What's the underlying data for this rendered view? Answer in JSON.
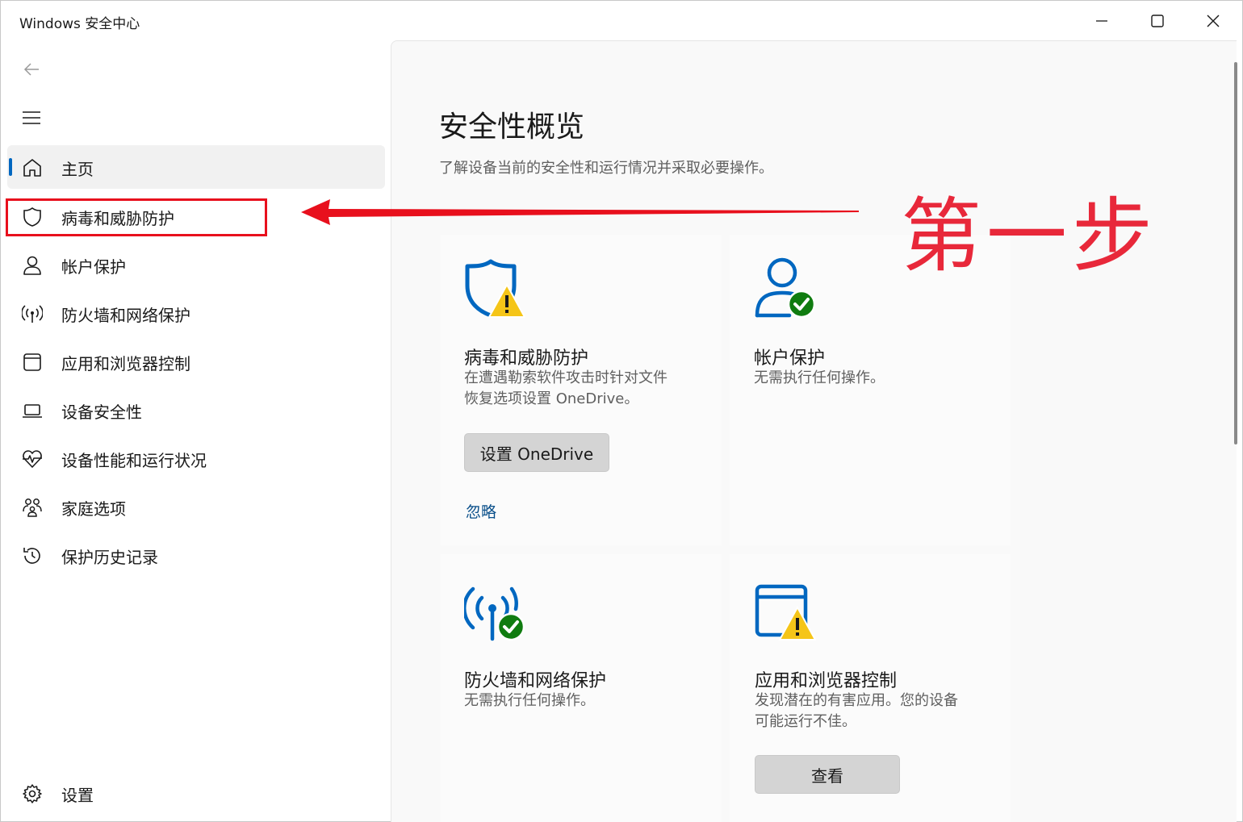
{
  "window": {
    "title": "Windows 安全中心"
  },
  "nav": {
    "items": [
      {
        "label": "主页",
        "icon": "home-icon",
        "active": true
      },
      {
        "label": "病毒和威胁防护",
        "icon": "shield-icon"
      },
      {
        "label": "帐户保护",
        "icon": "person-icon"
      },
      {
        "label": "防火墙和网络保护",
        "icon": "wifi-antenna-icon"
      },
      {
        "label": "应用和浏览器控制",
        "icon": "app-window-icon"
      },
      {
        "label": "设备安全性",
        "icon": "laptop-icon"
      },
      {
        "label": "设备性能和运行状况",
        "icon": "heart-pulse-icon"
      },
      {
        "label": "家庭选项",
        "icon": "family-icon"
      },
      {
        "label": "保护历史记录",
        "icon": "history-icon"
      }
    ],
    "settings_label": "设置"
  },
  "main": {
    "title": "安全性概览",
    "subtitle": "了解设备当前的安全性和运行情况并采取必要操作。",
    "cards": [
      {
        "title": "病毒和威胁防护",
        "desc_line1": "在遭遇勒索软件攻击时针对文件",
        "desc_line2": "恢复选项设置 OneDrive。",
        "button": "设置 OneDrive",
        "link": "忽略",
        "icon": "shield-warning-icon"
      },
      {
        "title": "帐户保护",
        "desc_line1": "无需执行任何操作。",
        "icon": "person-check-icon"
      },
      {
        "title": "防火墙和网络保护",
        "desc_line1": "无需执行任何操作。",
        "icon": "antenna-check-icon"
      },
      {
        "title": "应用和浏览器控制",
        "desc_line1": "发现潜在的有害应用。您的设备",
        "desc_line2": "可能运行不佳。",
        "button": "查看",
        "icon": "window-warning-icon"
      }
    ]
  },
  "annotation": {
    "text": "第一步",
    "color": "#e8283a"
  },
  "colors": {
    "accent": "#0067c0",
    "warning": "#f5c518",
    "success": "#107c10",
    "annotation_red": "#e8101d"
  }
}
